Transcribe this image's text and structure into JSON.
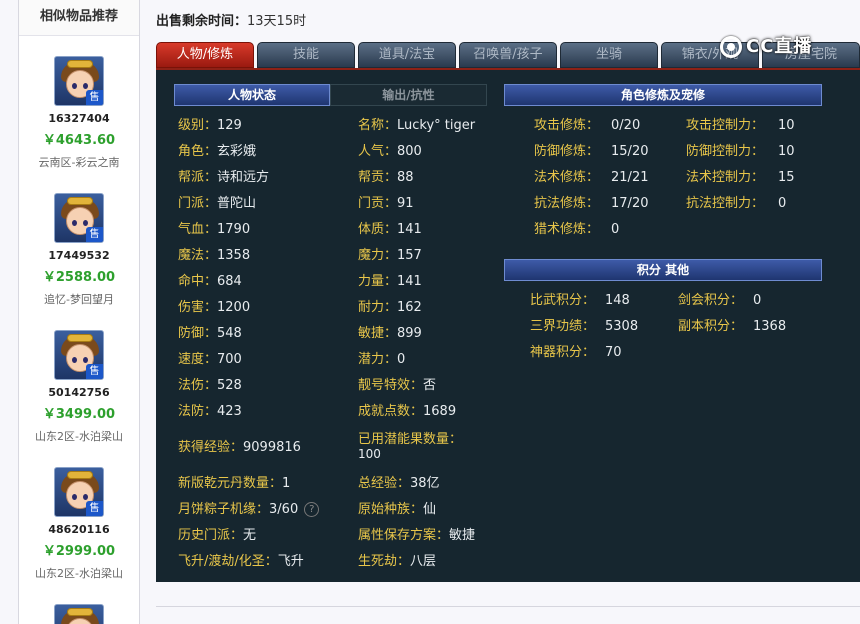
{
  "sidebar": {
    "title": "相似物品推荐",
    "items": [
      {
        "id": "16327404",
        "price": "￥4643.60",
        "server": "云南区-彩云之南",
        "badge": "售"
      },
      {
        "id": "17449532",
        "price": "￥2588.00",
        "server": "追忆-梦回望月",
        "badge": "售"
      },
      {
        "id": "50142756",
        "price": "￥3499.00",
        "server": "山东2区-水泊梁山",
        "badge": "售"
      },
      {
        "id": "48620116",
        "price": "￥2999.00",
        "server": "山东2区-水泊梁山",
        "badge": "售"
      }
    ]
  },
  "header": {
    "time_label": "出售剩余时间：",
    "time_value": "13天15时"
  },
  "tabs": [
    "人物/修炼",
    "技能",
    "道具/法宝",
    "召唤兽/孩子",
    "坐骑",
    "锦衣/外观",
    "房屋宅院"
  ],
  "logo": {
    "text": "CC直播"
  },
  "status": {
    "title": "人物状态",
    "subtab": "输出/抗性",
    "left": [
      {
        "k": "级别：",
        "v": "129"
      },
      {
        "k": "角色：",
        "v": "玄彩娥"
      },
      {
        "k": "帮派：",
        "v": "诗和远方"
      },
      {
        "k": "门派：",
        "v": "普陀山"
      },
      {
        "k": "气血：",
        "v": "1790"
      },
      {
        "k": "魔法：",
        "v": "1358"
      },
      {
        "k": "命中：",
        "v": "684"
      },
      {
        "k": "伤害：",
        "v": "1200"
      },
      {
        "k": "防御：",
        "v": "548"
      },
      {
        "k": "速度：",
        "v": "700"
      },
      {
        "k": "法伤：",
        "v": "528"
      },
      {
        "k": "法防：",
        "v": "423"
      },
      {
        "k": "获得经验：",
        "v": "9099816"
      },
      {
        "k": "新版乾元丹数量：",
        "v": "1"
      },
      {
        "k": "月饼粽子机缘：",
        "v": "3/60"
      },
      {
        "k": "历史门派：",
        "v": "无"
      },
      {
        "k": "飞升/渡劫/化圣：",
        "v": "飞升"
      }
    ],
    "right": [
      {
        "k": "名称：",
        "v": "Lucky° tiger"
      },
      {
        "k": "人气：",
        "v": "800"
      },
      {
        "k": "帮贡：",
        "v": "88"
      },
      {
        "k": "门贡：",
        "v": "91"
      },
      {
        "k": "体质：",
        "v": "141"
      },
      {
        "k": "魔力：",
        "v": "157"
      },
      {
        "k": "力量：",
        "v": "141"
      },
      {
        "k": "耐力：",
        "v": "162"
      },
      {
        "k": "敏捷：",
        "v": "899"
      },
      {
        "k": "潜力：",
        "v": "0"
      },
      {
        "k": "靓号特效：",
        "v": "否"
      },
      {
        "k": "成就点数：",
        "v": "1689"
      },
      {
        "k": "已用潜能果数量：",
        "v": "100"
      },
      {
        "k": "总经验：",
        "v": "38亿"
      },
      {
        "k": "原始种族：",
        "v": "仙"
      },
      {
        "k": "属性保存方案：",
        "v": "敏捷"
      },
      {
        "k": "生死劫：",
        "v": "八层"
      }
    ]
  },
  "cultivation": {
    "title": "角色修炼及宠修",
    "left": [
      {
        "k": "攻击修炼：",
        "v": "0/20"
      },
      {
        "k": "防御修炼：",
        "v": "15/20"
      },
      {
        "k": "法术修炼：",
        "v": "21/21"
      },
      {
        "k": "抗法修炼：",
        "v": "17/20"
      },
      {
        "k": "猎术修炼：",
        "v": "0"
      }
    ],
    "right": [
      {
        "k": "攻击控制力：",
        "v": "10"
      },
      {
        "k": "防御控制力：",
        "v": "10"
      },
      {
        "k": "法术控制力：",
        "v": "15"
      },
      {
        "k": "抗法控制力：",
        "v": "0"
      }
    ]
  },
  "points": {
    "title": "积分 其他",
    "left": [
      {
        "k": "比武积分：",
        "v": "148"
      },
      {
        "k": "三界功绩：",
        "v": "5308"
      },
      {
        "k": "神器积分：",
        "v": "70"
      }
    ],
    "right": [
      {
        "k": "剑会积分：",
        "v": "0"
      },
      {
        "k": "副本积分：",
        "v": "1368"
      }
    ]
  },
  "colors": {
    "label": "#e8c64a",
    "value": "#e8ecef",
    "panel": "#16262f",
    "price": "#2da02d",
    "active_tab": "#c0271a"
  }
}
